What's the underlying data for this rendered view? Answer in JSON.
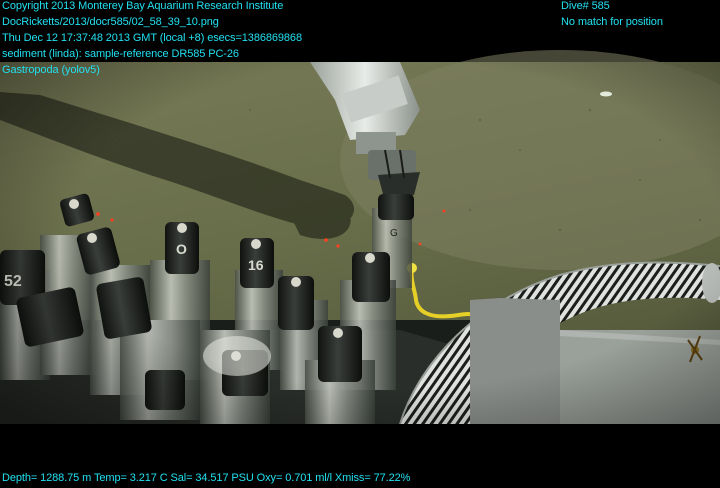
{
  "overlay": {
    "color": "#22e0f0",
    "top_left_lines": [
      "Copyright 2013 Monterey Bay Aquarium Research Institute",
      "DocRicketts/2013/docr585/02_58_39_10.png",
      "Thu Dec 12 17:37:48 2013 GMT (local +8)  esecs=1386869868",
      "sediment (linda): sample-reference DR585 PC-26",
      "Gastropoda (yolov5)"
    ],
    "top_right_lines": [
      "Dive# 585",
      "No match for position"
    ],
    "bottom_line": "Depth= 1288.75 m  Temp= 3.217 C  Sal= 34.517 PSU  Oxy= 0.701 ml/l  Xmiss= 77.22%"
  },
  "tube_labels": [
    "52",
    "O",
    "16",
    "G"
  ],
  "scene": {
    "seafloor_color": "#6e7450",
    "shadow_color": "#2c3020",
    "hose_stripe_color": "#1a1c1a",
    "hose_base_color": "#d8dcd8",
    "rope_color": "#e8d020",
    "laser_dot_color": "#ff4020"
  }
}
